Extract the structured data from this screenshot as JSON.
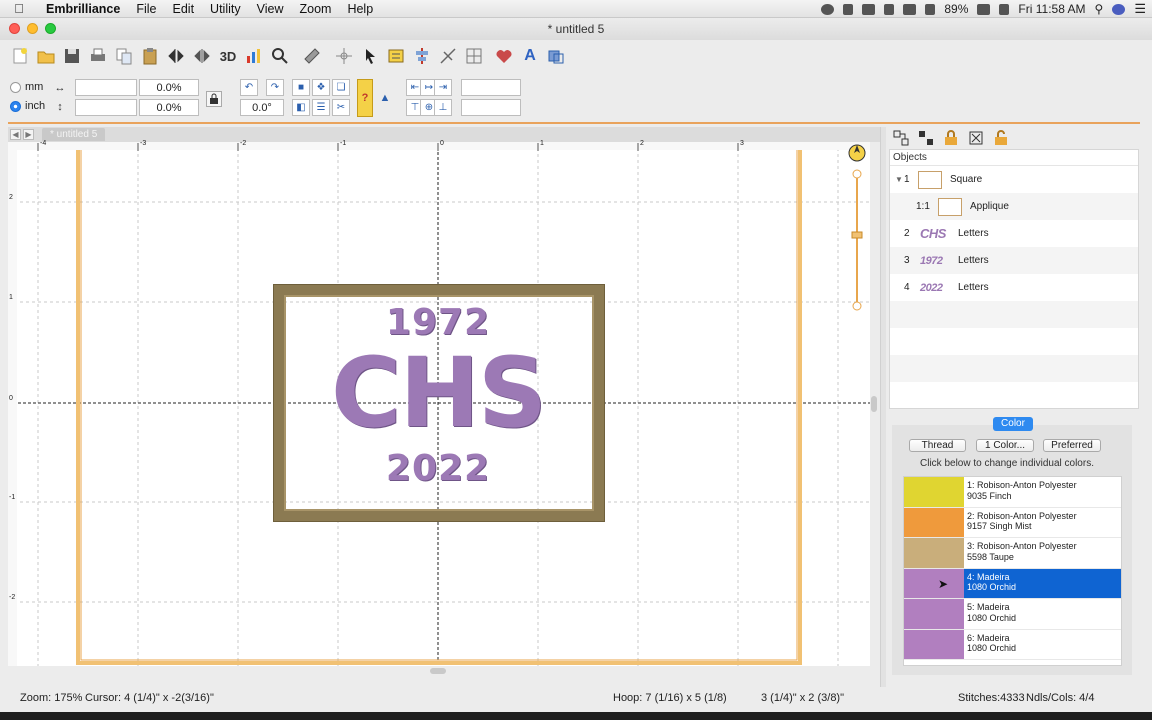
{
  "menubar": {
    "app_name": "Embrilliance",
    "items": [
      "File",
      "Edit",
      "Utility",
      "View",
      "Zoom",
      "Help"
    ],
    "battery": "89%",
    "clock": "Fri 11:58 AM"
  },
  "window": {
    "title": "* untitled 5",
    "tab": "* untitled 5"
  },
  "toolbar": {
    "threed_label": "3D",
    "text_tool_label": "A"
  },
  "properties": {
    "unit_mm": "mm",
    "unit_inch": "inch",
    "selected_unit": "inch",
    "width_value": "",
    "height_value": "",
    "width_percent": "0.0%",
    "height_percent": "0.0%",
    "rotation": "0.0°"
  },
  "canvas": {
    "ruler_top": [
      "-4",
      "-3",
      "-2",
      "-1",
      "0",
      "1",
      "2",
      "3"
    ],
    "ruler_left": [
      "2",
      "1",
      "0",
      "-1",
      "-2"
    ],
    "design": {
      "top_year": "1972",
      "main_text": "CHS",
      "bottom_year": "2022",
      "frame_color": "#8b7a52",
      "letters_color": "#9c79b5"
    }
  },
  "objects": {
    "header": "Objects",
    "rows": [
      {
        "num": "1",
        "label": "Square",
        "expanded": true
      },
      {
        "num": "1:1",
        "label": "Applique"
      },
      {
        "num": "2",
        "thumb": "CHS",
        "label": "Letters"
      },
      {
        "num": "3",
        "thumb": "1972",
        "label": "Letters"
      },
      {
        "num": "4",
        "thumb": "2022",
        "label": "Letters"
      }
    ]
  },
  "color_panel": {
    "tab_label": "Color",
    "buttons": [
      "Thread",
      "1 Color...",
      "Preferred"
    ],
    "hint": "Click below to change individual colors.",
    "threads": [
      {
        "line1": "1: Robison-Anton Polyester",
        "line2": "9035 Finch",
        "color": "#e0d531"
      },
      {
        "line1": "2: Robison-Anton Polyester",
        "line2": "9157 Singh Mist",
        "color": "#ef9a3c"
      },
      {
        "line1": "3: Robison-Anton Polyester",
        "line2": "5598 Taupe",
        "color": "#c9ae7b"
      },
      {
        "line1": "4: Madeira",
        "line2": "1080 Orchid",
        "color": "#b17fbf",
        "selected": true
      },
      {
        "line1": "5: Madeira",
        "line2": "1080 Orchid",
        "color": "#b17fbf"
      },
      {
        "line1": "6: Madeira",
        "line2": "1080 Orchid",
        "color": "#b17fbf"
      }
    ]
  },
  "status": {
    "zoom": "Zoom: 175%",
    "cursor": "Cursor: 4 (1/4)\" x -2(3/16)\"",
    "hoop": "Hoop: 7 (1/16) x 5 (1/8)",
    "size": "3 (1/4)\" x 2 (3/8)\"",
    "stitches": "Stitches:4333",
    "ndls": "Ndls/Cols: 4/4"
  }
}
